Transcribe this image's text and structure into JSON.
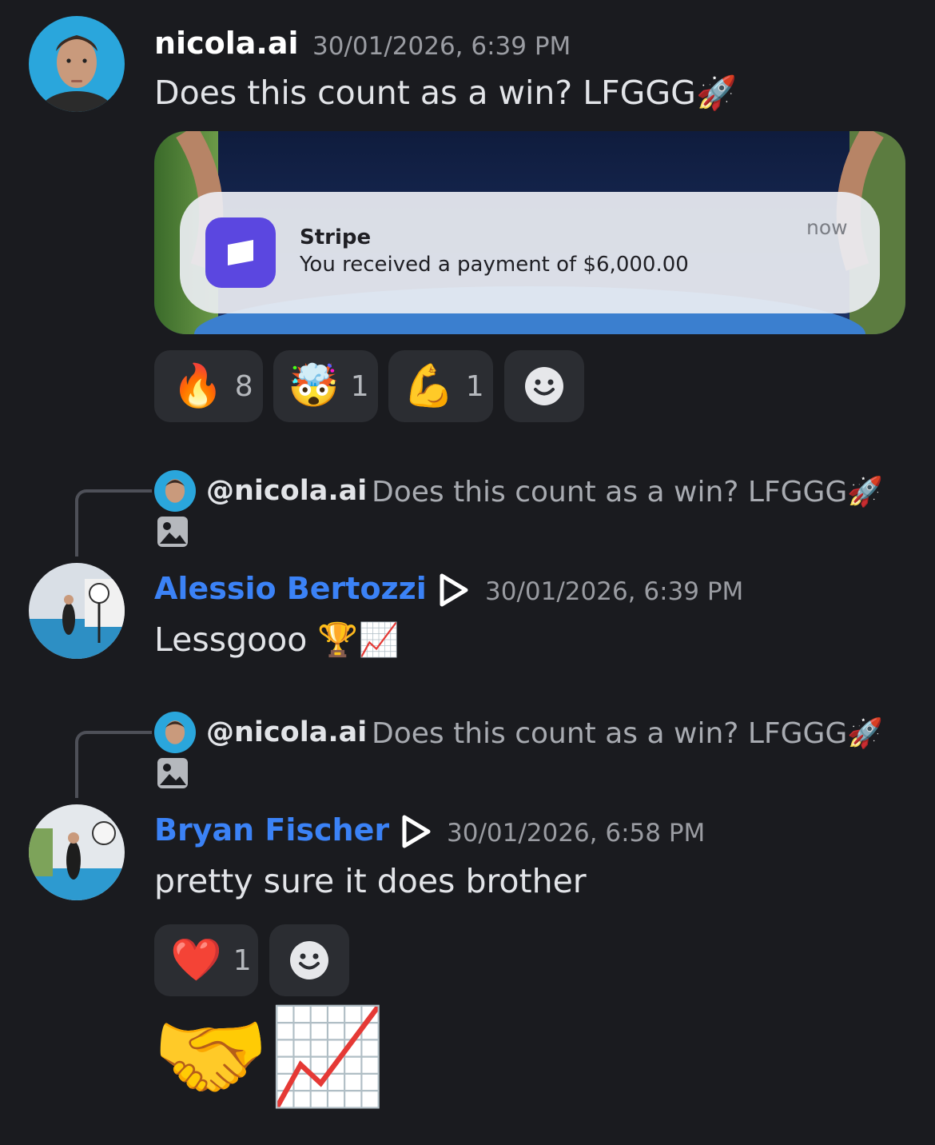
{
  "colors": {
    "background": "#1a1b1f",
    "link_name": "#3b82f6",
    "timestamp": "#9a9ca2",
    "reaction_bg": "#2b2d32",
    "stripe_brand": "#5b47e0"
  },
  "messages": [
    {
      "author": "nicola.ai",
      "timestamp": "30/01/2026, 6:39 PM",
      "text": "Does this count as a win? LFGGG",
      "text_emoji": "🚀",
      "attachment": {
        "app": "Stripe",
        "notification_text": "You received a payment of $6,000.00",
        "time": "now"
      },
      "reactions": [
        {
          "emoji": "🔥",
          "count": "8"
        },
        {
          "emoji": "🤯",
          "count": "1"
        },
        {
          "emoji": "💪",
          "count": "1"
        }
      ]
    },
    {
      "reply_to": {
        "mention": "@nicola.ai",
        "text": "Does this count as a win? LFGGG",
        "emoji": "🚀"
      },
      "author": "Alessio Bertozzi",
      "timestamp": "30/01/2026, 6:39 PM",
      "text": "Lessgooo",
      "text_emoji": "🏆📈"
    },
    {
      "reply_to": {
        "mention": "@nicola.ai",
        "text": "Does this count as a win? LFGGG",
        "emoji": "🚀"
      },
      "author": "Bryan Fischer",
      "timestamp": "30/01/2026, 6:58 PM",
      "text": "pretty sure it does brother",
      "reactions": [
        {
          "emoji": "❤️",
          "count": "1"
        }
      ],
      "followup_emoji": "🤝📈"
    }
  ]
}
